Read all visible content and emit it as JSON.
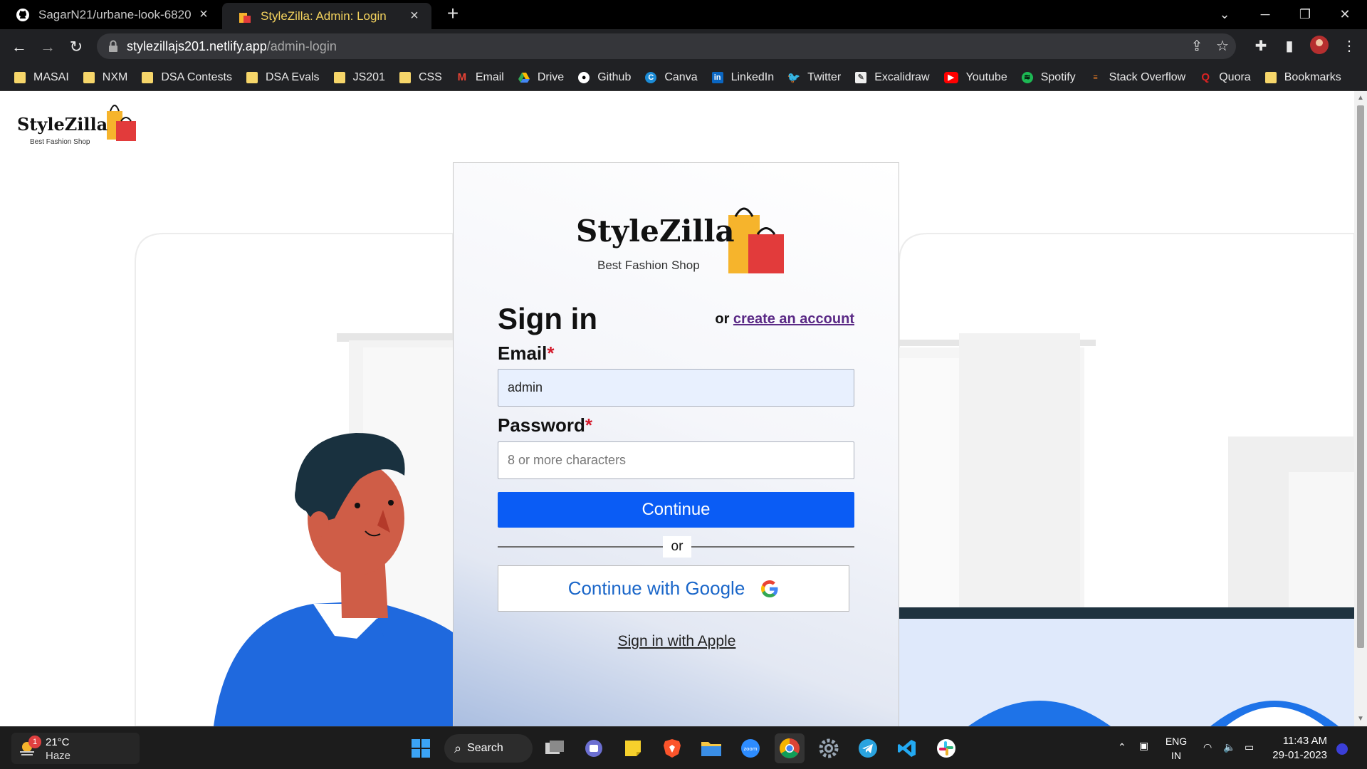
{
  "browser": {
    "tabs": [
      {
        "title": "SagarN21/urbane-look-6820"
      },
      {
        "title": "StyleZilla: Admin: Login"
      }
    ],
    "url_host": "stylezillajs201.netlify.app",
    "url_path": "/admin-login",
    "bookmarks": [
      "MASAI",
      "NXM",
      "DSA Contests",
      "DSA Evals",
      "JS201",
      "CSS",
      "Email",
      "Drive",
      "Github",
      "Canva",
      "LinkedIn",
      "Twitter",
      "Excalidraw",
      "Youtube",
      "Spotify",
      "Stack Overflow",
      "Quora",
      "Bookmarks"
    ]
  },
  "site": {
    "brand": "StyleZilla",
    "tagline": "Best Fashion Shop"
  },
  "login": {
    "title": "Sign in",
    "or_text": "or",
    "create_link": "create an account",
    "email_label": "Email",
    "email_value": "admin",
    "password_label": "Password",
    "password_placeholder": "8 or more characters",
    "required_mark": "*",
    "continue": "Continue",
    "divider_or": "or",
    "google": "Continue with Google",
    "apple": "Sign in with Apple"
  },
  "taskbar": {
    "weather_temp": "21°C",
    "weather_cond": "Haze",
    "weather_badge": "1",
    "search": "Search",
    "lang_1": "ENG",
    "lang_2": "IN",
    "time": "11:43 AM",
    "date": "29-01-2023"
  },
  "colors": {
    "primary": "#0a5cf5",
    "required": "#d41b2c",
    "link": "#5b2a86",
    "active_tab_text": "#f4d35e"
  }
}
